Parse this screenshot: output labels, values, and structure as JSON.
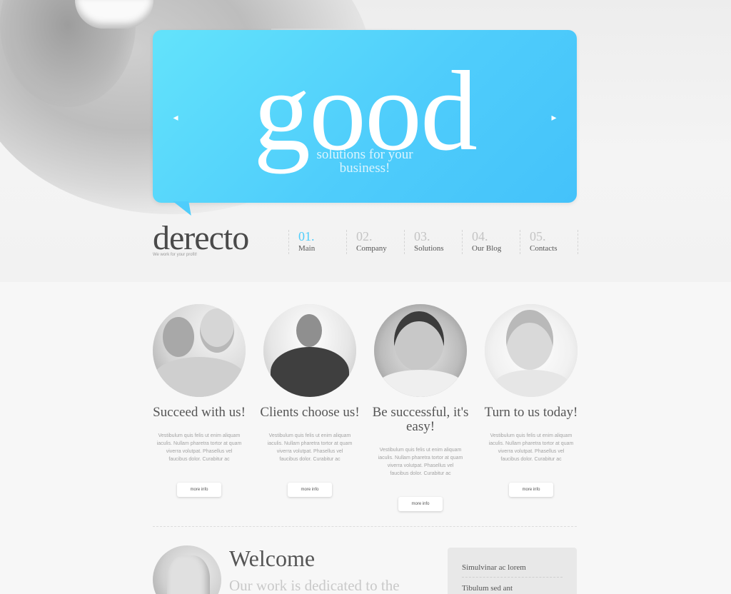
{
  "hero": {
    "headline": "good",
    "tagline_line1": "solutions for your",
    "tagline_line2": "business!",
    "prev_icon": "chevron-left-icon",
    "next_icon": "chevron-right-icon",
    "prev_glyph": "◂",
    "next_glyph": "▸"
  },
  "brand": {
    "logo": "derecto",
    "slogan": "We work for your profit!"
  },
  "nav": [
    {
      "num": "01.",
      "label": "Main",
      "active": true
    },
    {
      "num": "02.",
      "label": "Company"
    },
    {
      "num": "03.",
      "label": "Solutions"
    },
    {
      "num": "04.",
      "label": "Our Blog"
    },
    {
      "num": "05.",
      "label": "Contacts"
    }
  ],
  "features": [
    {
      "title": "Succeed with us!",
      "text": "Vestibulum quis felis ut enim aliquam iaculis. Nullam pharetra tortor at quam viverra volutpat. Phasellus vel faucibus dolor. Curabitur ac",
      "button": "more info"
    },
    {
      "title": "Clients choose us!",
      "text": "Vestibulum quis felis ut enim aliquam iaculis. Nullam pharetra tortor at quam viverra volutpat. Phasellus vel faucibus dolor. Curabitur ac",
      "button": "more info"
    },
    {
      "title": "Be successful, it's easy!",
      "text": "Vestibulum quis felis ut enim aliquam iaculis. Nullam pharetra tortor at quam viverra volutpat. Phasellus vel faucibus dolor. Curabitur ac",
      "button": "more info"
    },
    {
      "title": "Turn to us today!",
      "text": "Vestibulum quis felis ut enim aliquam iaculis. Nullam pharetra tortor at quam viverra volutpat. Phasellus vel faucibus dolor. Curabitur ac",
      "button": "more info"
    }
  ],
  "welcome": {
    "title": "Welcome",
    "subtitle": "Our work is dedicated to the"
  },
  "sidebar": {
    "links": [
      "Simulvinar ac lorem",
      "Tibulum sed ant"
    ]
  },
  "colors": {
    "accent": "#4fcdfb",
    "banner_light": "#63e3fb",
    "text_dark": "#4a4a4a"
  }
}
